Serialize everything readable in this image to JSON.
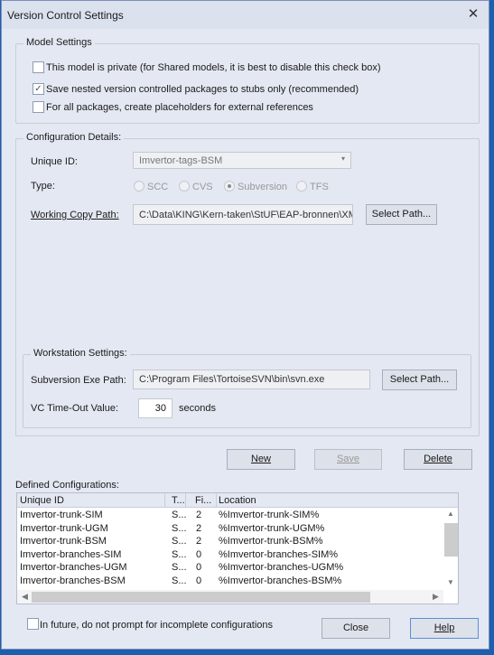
{
  "window": {
    "title": "Version Control Settings",
    "close_icon": "close-icon"
  },
  "model_settings": {
    "legend": "Model Settings",
    "options": [
      {
        "label": "This model is private (for Shared models, it is best to disable this check box)",
        "checked": false
      },
      {
        "label": "Save nested version controlled packages to stubs only (recommended)",
        "checked": true
      },
      {
        "label": "For all packages, create placeholders for external references",
        "checked": false
      }
    ]
  },
  "config": {
    "legend": "Configuration Details:",
    "unique_id_label": "Unique ID:",
    "unique_id_value": "Imvertor-tags-BSM",
    "type_label": "Type:",
    "types": [
      {
        "label": "SCC",
        "selected": false
      },
      {
        "label": "CVS",
        "selected": false
      },
      {
        "label": "Subversion",
        "selected": true
      },
      {
        "label": "TFS",
        "selected": false
      }
    ],
    "working_copy_label": "Working Copy Path:",
    "working_copy_value": "C:\\Data\\KING\\Kern-taken\\StUF\\EAP-bronnen\\XMI-dat",
    "select_path": "Select Path..."
  },
  "workstation": {
    "legend": "Workstation Settings:",
    "exe_label": "Subversion Exe Path:",
    "exe_value": "C:\\Program Files\\TortoiseSVN\\bin\\svn.exe",
    "select_path": "Select Path...",
    "timeout_label": "VC Time-Out Value:",
    "timeout_value": "30",
    "timeout_unit": "seconds"
  },
  "actions": {
    "new": "New",
    "save": "Save",
    "delete": "Delete"
  },
  "defined": {
    "label": "Defined Configurations:",
    "columns": [
      "Unique ID",
      "T...",
      "Fi...",
      "Location"
    ],
    "rows": [
      [
        "Imvertor-trunk-SIM",
        "S...",
        "2",
        "%Imvertor-trunk-SIM%"
      ],
      [
        "Imvertor-trunk-UGM",
        "S...",
        "2",
        "%Imvertor-trunk-UGM%"
      ],
      [
        "Imvertor-trunk-BSM",
        "S...",
        "2",
        "%Imvertor-trunk-BSM%"
      ],
      [
        "Imvertor-branches-SIM",
        "S...",
        "0",
        "%Imvertor-branches-SIM%"
      ],
      [
        "Imvertor-branches-UGM",
        "S...",
        "0",
        "%Imvertor-branches-UGM%"
      ],
      [
        "Imvertor-branches-BSM",
        "S...",
        "0",
        "%Imvertor-branches-BSM%"
      ]
    ]
  },
  "footer": {
    "no_prompt_label": "In future, do not prompt for incomplete configurations",
    "no_prompt_checked": false,
    "close": "Close",
    "help": "Help"
  }
}
